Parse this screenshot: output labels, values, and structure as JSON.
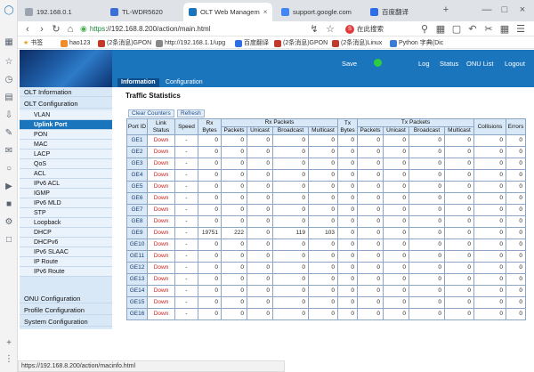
{
  "browser": {
    "tabs": [
      {
        "label": "192.168.0.1",
        "fav_color": "#9aa4b0"
      },
      {
        "label": "TL-WDR5620",
        "fav_color": "#3a6fd8"
      },
      {
        "label": "OLT Web Managem",
        "fav_color": "#1b75bc"
      },
      {
        "label": "support.google.com",
        "fav_color": "#4285f4"
      },
      {
        "label": "百度翻译",
        "fav_color": "#2d6ee6"
      }
    ],
    "url_scheme": "https",
    "url_rest": "://192.168.8.200/action/main.html",
    "search_placeholder": "在此搜索",
    "bookmarks": [
      "书签",
      "hao123",
      "(2条消息)GPON",
      "http://192.168.1.1/upg",
      "百度翻译",
      "(2条消息)GPON",
      "(2条消息)Linux",
      "Python 字典(Dic"
    ],
    "status_url": "https://192.168.8.200/action/macinfo.html"
  },
  "topnav": {
    "save": "Save",
    "log": "Log",
    "status": "Status",
    "onu_list": "ONU List",
    "logout": "Logout",
    "save_indicator_color": "#2ecc40"
  },
  "subtabs": [
    "Information",
    "Configuration"
  ],
  "menu": {
    "olt_information": "OLT Information",
    "olt_configuration": "OLT Configuration",
    "items": [
      "VLAN",
      "Uplink Port",
      "PON",
      "MAC",
      "LACP",
      "QoS",
      "ACL",
      "IPv6 ACL",
      "IGMP",
      "IPv6 MLD",
      "STP",
      "Loopback",
      "DHCP",
      "DHCPv6",
      "IPv6 SLAAC",
      "IP Route",
      "IPv6 Route"
    ],
    "onu_configuration": "ONU Configuration",
    "profile_configuration": "Profile Configuration",
    "system_configuration": "System Configuration"
  },
  "page": {
    "title": "Traffic Statistics",
    "clear_counters": "Clear Counters",
    "refresh": "Refresh"
  },
  "table": {
    "headers": {
      "port_id": "Port ID",
      "link_status": "Link Status",
      "speed": "Speed",
      "rx_bytes": "Rx Bytes",
      "rx_packets": "Rx Packets",
      "tx_bytes": "Tx Bytes",
      "tx_packets": "Tx Packets",
      "collisions": "Collisions",
      "errors": "Errors",
      "packets": "Packets",
      "unicast": "Unicast",
      "broadcast": "Broadcast",
      "multicast": "Multicast"
    },
    "rows": [
      [
        "GE1",
        "Down",
        "-",
        "0",
        "0",
        "0",
        "0",
        "0",
        "0",
        "0",
        "0",
        "0",
        "0",
        "0",
        "0"
      ],
      [
        "GE2",
        "Down",
        "-",
        "0",
        "0",
        "0",
        "0",
        "0",
        "0",
        "0",
        "0",
        "0",
        "0",
        "0",
        "0"
      ],
      [
        "GE3",
        "Down",
        "-",
        "0",
        "0",
        "0",
        "0",
        "0",
        "0",
        "0",
        "0",
        "0",
        "0",
        "0",
        "0"
      ],
      [
        "GE4",
        "Down",
        "-",
        "0",
        "0",
        "0",
        "0",
        "0",
        "0",
        "0",
        "0",
        "0",
        "0",
        "0",
        "0"
      ],
      [
        "GE5",
        "Down",
        "-",
        "0",
        "0",
        "0",
        "0",
        "0",
        "0",
        "0",
        "0",
        "0",
        "0",
        "0",
        "0"
      ],
      [
        "GE6",
        "Down",
        "-",
        "0",
        "0",
        "0",
        "0",
        "0",
        "0",
        "0",
        "0",
        "0",
        "0",
        "0",
        "0"
      ],
      [
        "GE7",
        "Down",
        "-",
        "0",
        "0",
        "0",
        "0",
        "0",
        "0",
        "0",
        "0",
        "0",
        "0",
        "0",
        "0"
      ],
      [
        "GE8",
        "Down",
        "-",
        "0",
        "0",
        "0",
        "0",
        "0",
        "0",
        "0",
        "0",
        "0",
        "0",
        "0",
        "0"
      ],
      [
        "GE9",
        "Down",
        "-",
        "19751",
        "222",
        "0",
        "119",
        "103",
        "0",
        "0",
        "0",
        "0",
        "0",
        "0",
        "0"
      ],
      [
        "GE10",
        "Down",
        "-",
        "0",
        "0",
        "0",
        "0",
        "0",
        "0",
        "0",
        "0",
        "0",
        "0",
        "0",
        "0"
      ],
      [
        "GE11",
        "Down",
        "-",
        "0",
        "0",
        "0",
        "0",
        "0",
        "0",
        "0",
        "0",
        "0",
        "0",
        "0",
        "0"
      ],
      [
        "GE12",
        "Down",
        "-",
        "0",
        "0",
        "0",
        "0",
        "0",
        "0",
        "0",
        "0",
        "0",
        "0",
        "0",
        "0"
      ],
      [
        "GE13",
        "Down",
        "-",
        "0",
        "0",
        "0",
        "0",
        "0",
        "0",
        "0",
        "0",
        "0",
        "0",
        "0",
        "0"
      ],
      [
        "GE14",
        "Down",
        "-",
        "0",
        "0",
        "0",
        "0",
        "0",
        "0",
        "0",
        "0",
        "0",
        "0",
        "0",
        "0"
      ],
      [
        "GE15",
        "Down",
        "-",
        "0",
        "0",
        "0",
        "0",
        "0",
        "0",
        "0",
        "0",
        "0",
        "0",
        "0",
        "0"
      ],
      [
        "GE16",
        "Down",
        "-",
        "0",
        "0",
        "0",
        "0",
        "0",
        "0",
        "0",
        "0",
        "0",
        "0",
        "0",
        "0"
      ]
    ]
  }
}
